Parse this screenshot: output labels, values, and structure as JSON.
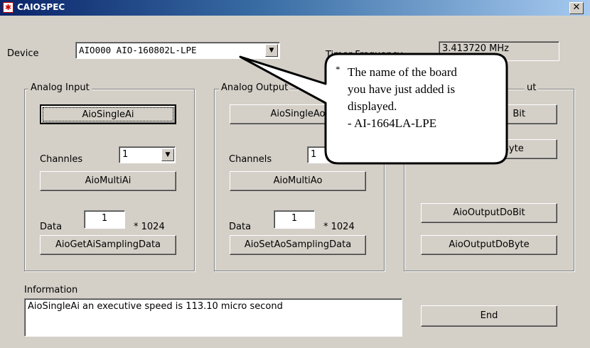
{
  "window": {
    "title": "CAIOSPEC",
    "close_glyph": "✕"
  },
  "device": {
    "label": "Device",
    "value": "AIO000 AIO-160802L-LPE",
    "arrow": "▼"
  },
  "timer": {
    "label": "Timer Frequency",
    "value": "3.413720 MHz"
  },
  "analog_input": {
    "legend": "Analog Input",
    "single_button": "AioSingleAi",
    "channels_label": "Channles",
    "channels_value": "1",
    "multi_button": "AioMultiAi",
    "data_label": "Data",
    "data_value": "1",
    "data_multiplier": "* 1024",
    "sampling_button": "AioGetAiSamplingData"
  },
  "analog_output": {
    "legend": "Analog Output",
    "single_button": "AioSingleAo",
    "channels_label": "Channels",
    "channels_value": "1",
    "multi_button": "AioMultiAo",
    "data_label": "Data",
    "data_value": "1",
    "data_multiplier": "* 1024",
    "sampling_button": "AioSetAoSamplingData"
  },
  "digital": {
    "legend": "ut",
    "input_bit_button": "Bit",
    "input_byte_button": "AioInputDiByte",
    "output_bit_button": "AioOutputDoBit",
    "output_byte_button": "AioOutputDoByte"
  },
  "information": {
    "label": "Information",
    "text": "AioSingleAi an executive speed is 113.10 micro second"
  },
  "end_button": "End",
  "callout": {
    "bullet": "*",
    "line1": "The name of the board",
    "line2": "you have just added is",
    "line3": "displayed.",
    "line4": "- AI-1664LA-LPE"
  }
}
